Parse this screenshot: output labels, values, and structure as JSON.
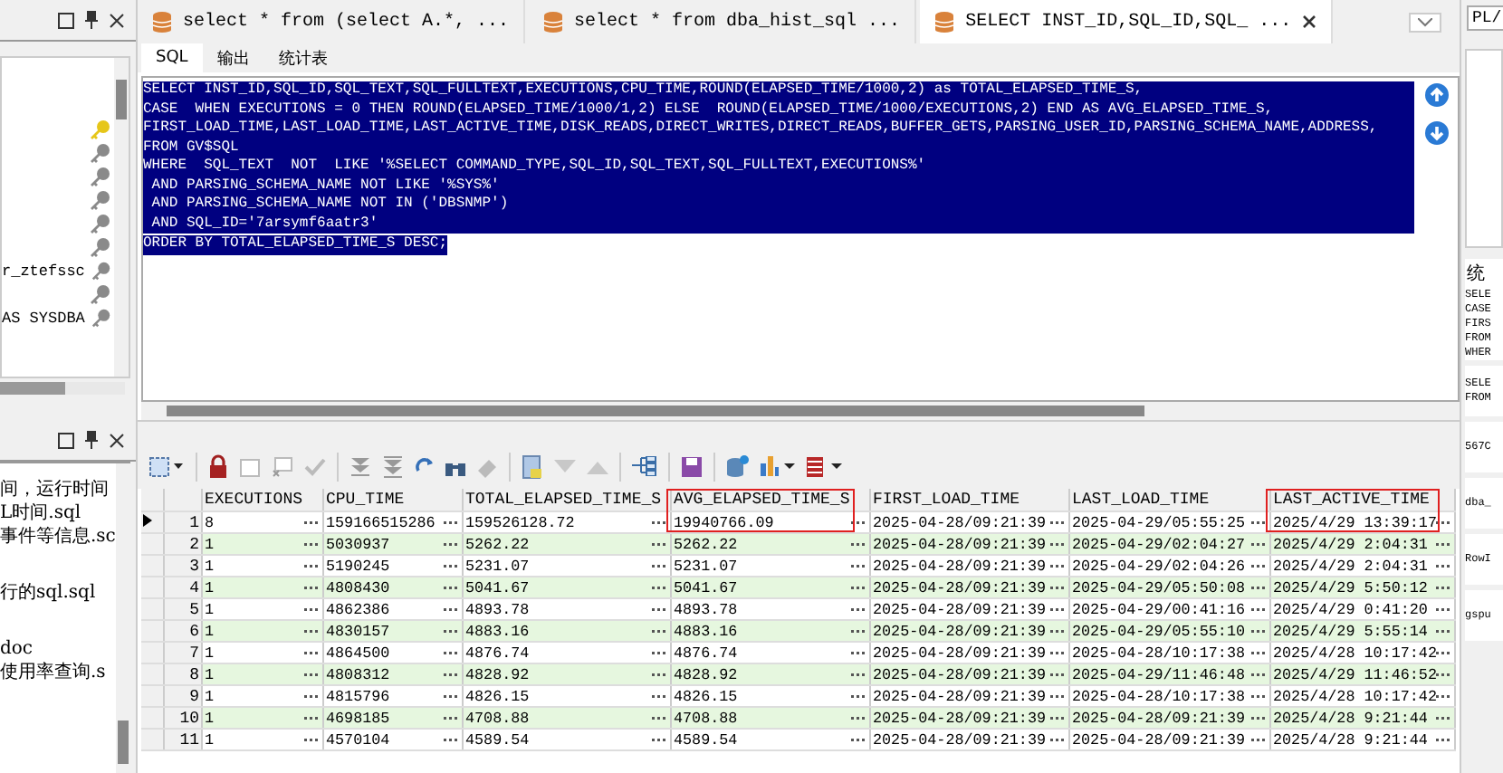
{
  "left_panel": {
    "tree_items": [
      {
        "connected": true
      },
      {
        "connected": false
      },
      {
        "connected": false
      },
      {
        "connected": false
      },
      {
        "connected": false
      },
      {
        "connected": false
      },
      {
        "label": "r_ztefssc",
        "connected": false
      },
      {
        "connected": false
      },
      {
        "label": "AS SYSDBA",
        "connected": false
      }
    ],
    "file_groups": [
      [
        "间，运行时间",
        "L时间.sql",
        "事件等信息.sc"
      ],
      [
        "行的sql.sql"
      ],
      [
        "doc",
        "使用率查询.s"
      ]
    ]
  },
  "tabs": [
    {
      "label": "select * from (select A.*, ...",
      "selected": false
    },
    {
      "label": "select * from dba_hist_sql ...",
      "selected": false
    },
    {
      "label": "SELECT INST_ID,SQL_ID,SQL_ ...",
      "selected": true
    }
  ],
  "sub_tabs": [
    {
      "label": "SQL",
      "selected": true
    },
    {
      "label": "输出",
      "selected": false
    },
    {
      "label": "统计表",
      "selected": false
    }
  ],
  "editor": {
    "selected": true,
    "lines": [
      "SELECT INST_ID,SQL_ID,SQL_TEXT,SQL_FULLTEXT,EXECUTIONS,CPU_TIME,ROUND(ELAPSED_TIME/1000,2) as TOTAL_ELAPSED_TIME_S,",
      "CASE  WHEN EXECUTIONS = 0 THEN ROUND(ELAPSED_TIME/1000/1,2) ELSE  ROUND(ELAPSED_TIME/1000/EXECUTIONS,2) END AS AVG_ELAPSED_TIME_S,",
      "FIRST_LOAD_TIME,LAST_LOAD_TIME,LAST_ACTIVE_TIME,DISK_READS,DIRECT_WRITES,DIRECT_READS,BUFFER_GETS,PARSING_USER_ID,PARSING_SCHEMA_NAME,ADDRESS,",
      "FROM GV$SQL",
      "WHERE  SQL_TEXT  NOT  LIKE '%SELECT COMMAND_TYPE,SQL_ID,SQL_TEXT,SQL_FULLTEXT,EXECUTIONS%'",
      " AND PARSING_SCHEMA_NAME NOT LIKE '%SYS%'",
      " AND PARSING_SCHEMA_NAME NOT IN ('DBSNMP')",
      " AND SQL_ID='7arsymf6aatr3'",
      "ORDER BY TOTAL_ELAPSED_TIME_S DESC;"
    ]
  },
  "table": {
    "columns": [
      {
        "label": "EXECUTIONS",
        "highlighted": false
      },
      {
        "label": "CPU_TIME",
        "highlighted": false
      },
      {
        "label": "TOTAL_ELAPSED_TIME_S",
        "highlighted": false
      },
      {
        "label": "AVG_ELAPSED_TIME_S",
        "highlighted": true
      },
      {
        "label": "FIRST_LOAD_TIME",
        "highlighted": false
      },
      {
        "label": "LAST_LOAD_TIME",
        "highlighted": false
      },
      {
        "label": "LAST_ACTIVE_TIME",
        "highlighted": true
      }
    ],
    "rows": [
      {
        "number": "1",
        "selected": true,
        "cells": [
          "8",
          "159166515286",
          "159526128.72",
          "19940766.09",
          "2025-04-28/09:21:39",
          "2025-04-29/05:55:25",
          "2025/4/29 13:39:17"
        ]
      },
      {
        "number": "2",
        "selected": false,
        "cells": [
          "1",
          "5030937",
          "5262.22",
          "5262.22",
          "2025-04-28/09:21:39",
          "2025-04-29/02:04:27",
          "2025/4/29 2:04:31"
        ]
      },
      {
        "number": "3",
        "selected": false,
        "cells": [
          "1",
          "5190245",
          "5231.07",
          "5231.07",
          "2025-04-28/09:21:39",
          "2025-04-29/02:04:26",
          "2025/4/29 2:04:31"
        ]
      },
      {
        "number": "4",
        "selected": false,
        "cells": [
          "1",
          "4808430",
          "5041.67",
          "5041.67",
          "2025-04-28/09:21:39",
          "2025-04-29/05:50:08",
          "2025/4/29 5:50:12"
        ]
      },
      {
        "number": "5",
        "selected": false,
        "cells": [
          "1",
          "4862386",
          "4893.78",
          "4893.78",
          "2025-04-28/09:21:39",
          "2025-04-29/00:41:16",
          "2025/4/29 0:41:20"
        ]
      },
      {
        "number": "6",
        "selected": false,
        "cells": [
          "1",
          "4830157",
          "4883.16",
          "4883.16",
          "2025-04-28/09:21:39",
          "2025-04-29/05:55:10",
          "2025/4/29 5:55:14"
        ]
      },
      {
        "number": "7",
        "selected": false,
        "cells": [
          "1",
          "4864500",
          "4876.74",
          "4876.74",
          "2025-04-28/09:21:39",
          "2025-04-28/10:17:38",
          "2025/4/28 10:17:42"
        ]
      },
      {
        "number": "8",
        "selected": false,
        "cells": [
          "1",
          "4808312",
          "4828.92",
          "4828.92",
          "2025-04-28/09:21:39",
          "2025-04-29/11:46:48",
          "2025/4/29 11:46:52"
        ]
      },
      {
        "number": "9",
        "selected": false,
        "cells": [
          "1",
          "4815796",
          "4826.15",
          "4826.15",
          "2025-04-28/09:21:39",
          "2025-04-28/10:17:38",
          "2025/4/28 10:17:42"
        ]
      },
      {
        "number": "10",
        "selected": false,
        "cells": [
          "1",
          "4698185",
          "4708.88",
          "4708.88",
          "2025-04-28/09:21:39",
          "2025-04-28/09:21:39",
          "2025/4/28 9:21:44"
        ]
      },
      {
        "number": "11",
        "selected": false,
        "cells": [
          "1",
          "4570104",
          "4589.54",
          "4589.54",
          "2025-04-28/09:21:39",
          "2025-04-28/09:21:39",
          "2025/4/28 9:21:44"
        ]
      }
    ]
  },
  "right_panel": {
    "button": "PL/",
    "heading": "统",
    "preview_lines": [
      "SELE",
      "CASE",
      "FIRS",
      "FROM",
      "WHER"
    ],
    "items": [
      "SELE\nFROM",
      "567C",
      "dba_",
      "RowI",
      "gspu"
    ]
  }
}
